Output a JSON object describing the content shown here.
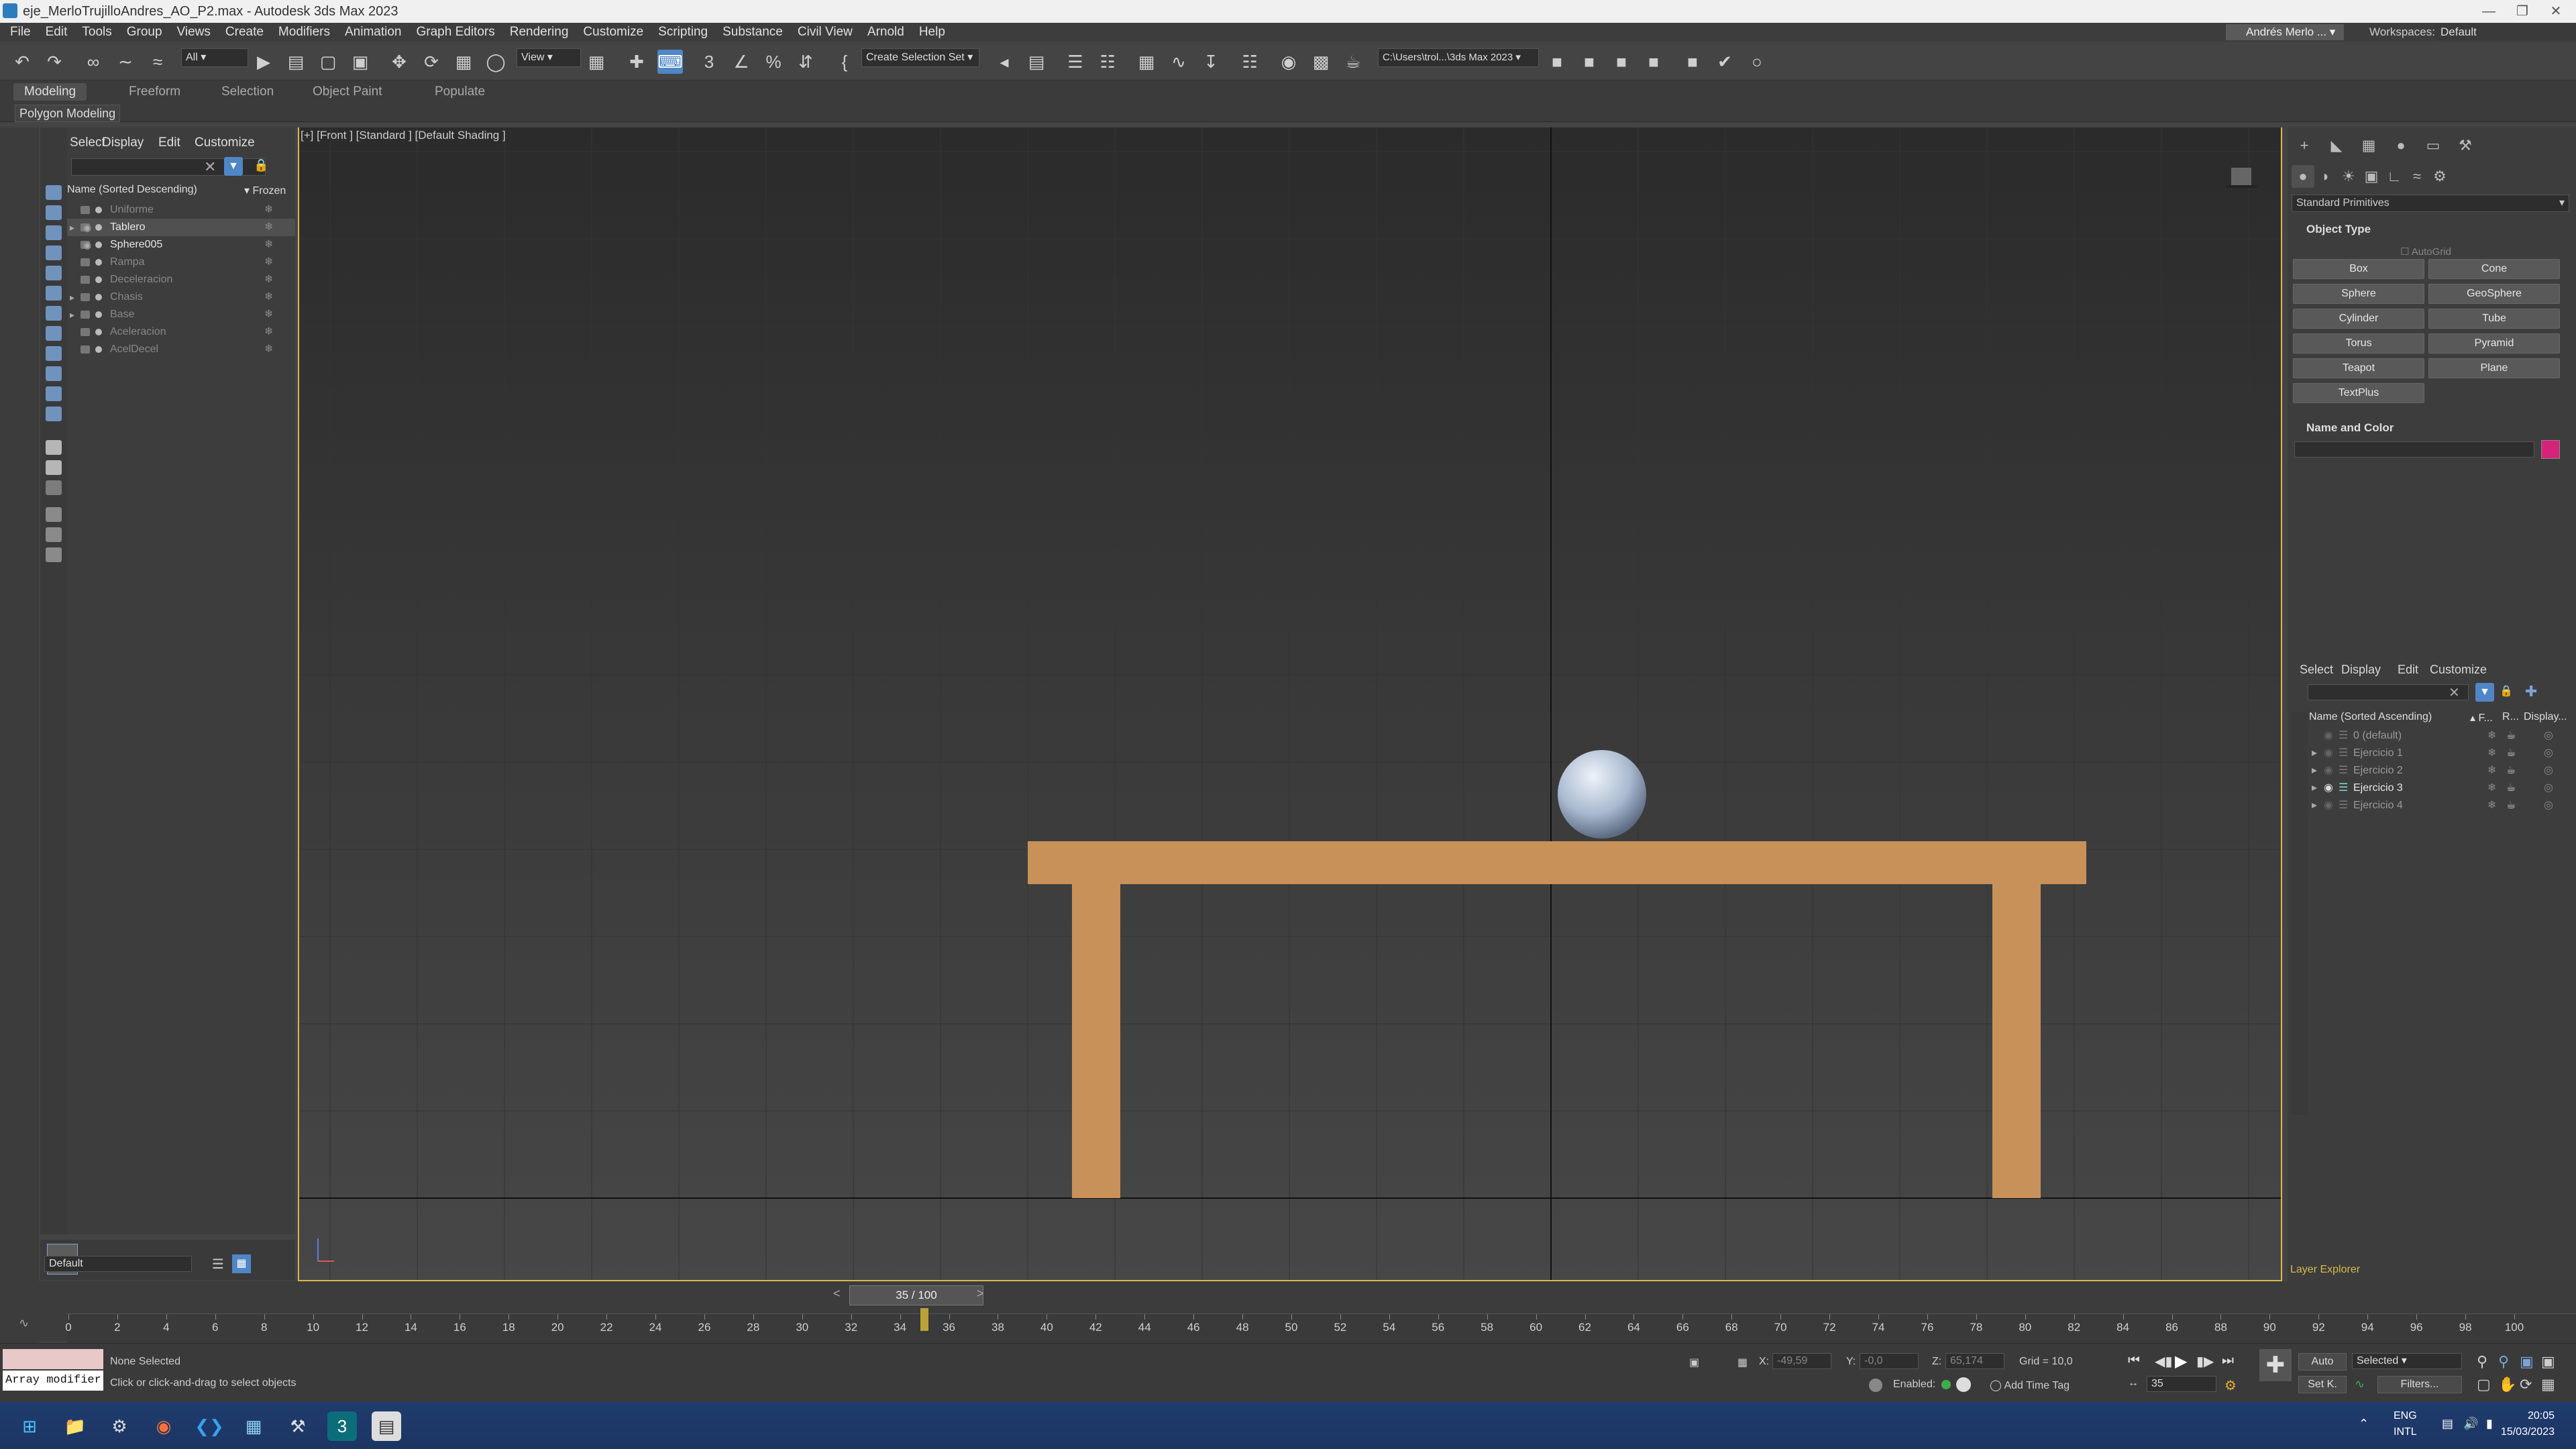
{
  "window": {
    "title": "eje_MerloTrujilloAndres_AO_P2.max - Autodesk 3ds Max 2023",
    "user": "Andrés Merlo ...",
    "workspaces_label": "Workspaces:",
    "workspace": "Default"
  },
  "menu": [
    "File",
    "Edit",
    "Tools",
    "Group",
    "Views",
    "Create",
    "Modifiers",
    "Animation",
    "Graph Editors",
    "Rendering",
    "Customize",
    "Scripting",
    "Substance",
    "Civil View",
    "Arnold",
    "Help"
  ],
  "toolbar": {
    "filter": "All",
    "coord": "View",
    "selection_set": "Create Selection Set",
    "path": "C:\\Users\\trol...\\3ds Max 2023"
  },
  "ribbon": {
    "tabs": [
      "Modeling",
      "Freeform",
      "Selection",
      "Object Paint",
      "Populate"
    ],
    "active": "Modeling",
    "panel": "Polygon Modeling"
  },
  "scene_explorer": {
    "menus": [
      "Select",
      "Display",
      "Edit",
      "Customize"
    ],
    "col_name": "Name (Sorted Descending)",
    "col_frozen": "▾ Frozen",
    "items": [
      {
        "name": "Uniforme",
        "visible": false,
        "expand": false
      },
      {
        "name": "Tablero",
        "visible": true,
        "expand": true
      },
      {
        "name": "Sphere005",
        "visible": true,
        "expand": false
      },
      {
        "name": "Rampa",
        "visible": false,
        "expand": false
      },
      {
        "name": "Deceleracion",
        "visible": false,
        "expand": false
      },
      {
        "name": "Chasis",
        "visible": false,
        "expand": true
      },
      {
        "name": "Base",
        "visible": false,
        "expand": true
      },
      {
        "name": "Aceleracion",
        "visible": false,
        "expand": false
      },
      {
        "name": "AcelDecel",
        "visible": false,
        "expand": false
      }
    ],
    "layer_default": "Default"
  },
  "viewport": {
    "label": "[+] [Front ] [Standard ] [Default Shading ]",
    "table_color": "#c8915a",
    "sphere_color": "#b8c6d8"
  },
  "command_panel": {
    "category": "Standard Primitives",
    "object_type": "Object Type",
    "autogrid": "AutoGrid",
    "buttons": [
      "Box",
      "Cone",
      "Sphere",
      "GeoSphere",
      "Cylinder",
      "Tube",
      "Torus",
      "Pyramid",
      "Teapot",
      "Plane",
      "TextPlus"
    ],
    "name_color": "Name and Color",
    "swatch": "#d6237a"
  },
  "layer_explorer": {
    "menus": [
      "Select",
      "Display",
      "Edit",
      "Customize"
    ],
    "col_name": "Name (Sorted Ascending)",
    "col_f": "▴ F...",
    "col_r": "R...",
    "col_d": "Display...",
    "items": [
      "0 (default)",
      "Ejercicio 1",
      "Ejercicio 2",
      "Ejercicio 3",
      "Ejercicio 4"
    ],
    "current": "Ejercicio 3",
    "footer": "Layer Explorer"
  },
  "timeline": {
    "frame": "35 / 100",
    "current": 35,
    "end": 100,
    "labels": [
      0,
      2,
      4,
      6,
      8,
      10,
      12,
      14,
      16,
      18,
      20,
      22,
      24,
      26,
      28,
      30,
      32,
      34,
      36,
      38,
      40,
      42,
      44,
      46,
      48,
      50,
      52,
      54,
      56,
      58,
      60,
      62,
      64,
      66,
      68,
      70,
      72,
      74,
      76,
      78,
      80,
      82,
      84,
      86,
      88,
      90,
      92,
      94,
      96,
      98,
      100
    ]
  },
  "status": {
    "selection": "None Selected",
    "hint": "Click or click-and-drag to select objects",
    "maxscript": "Array modifier",
    "x_label": "X:",
    "x": "-49,59",
    "y_label": "Y:",
    "y": "-0,0",
    "z_label": "Z:",
    "z": "65,174",
    "grid": "Grid = 10,0",
    "enabled": "Enabled:",
    "add_time_tag": "Add Time Tag",
    "auto": "Auto",
    "set_k": "Set K.",
    "key_filter": "Selected",
    "filters": "Filters...",
    "frame_field": "35"
  },
  "taskbar": {
    "lang1": "ENG",
    "lang2": "INTL",
    "time": "20:05",
    "date": "15/03/2023"
  }
}
